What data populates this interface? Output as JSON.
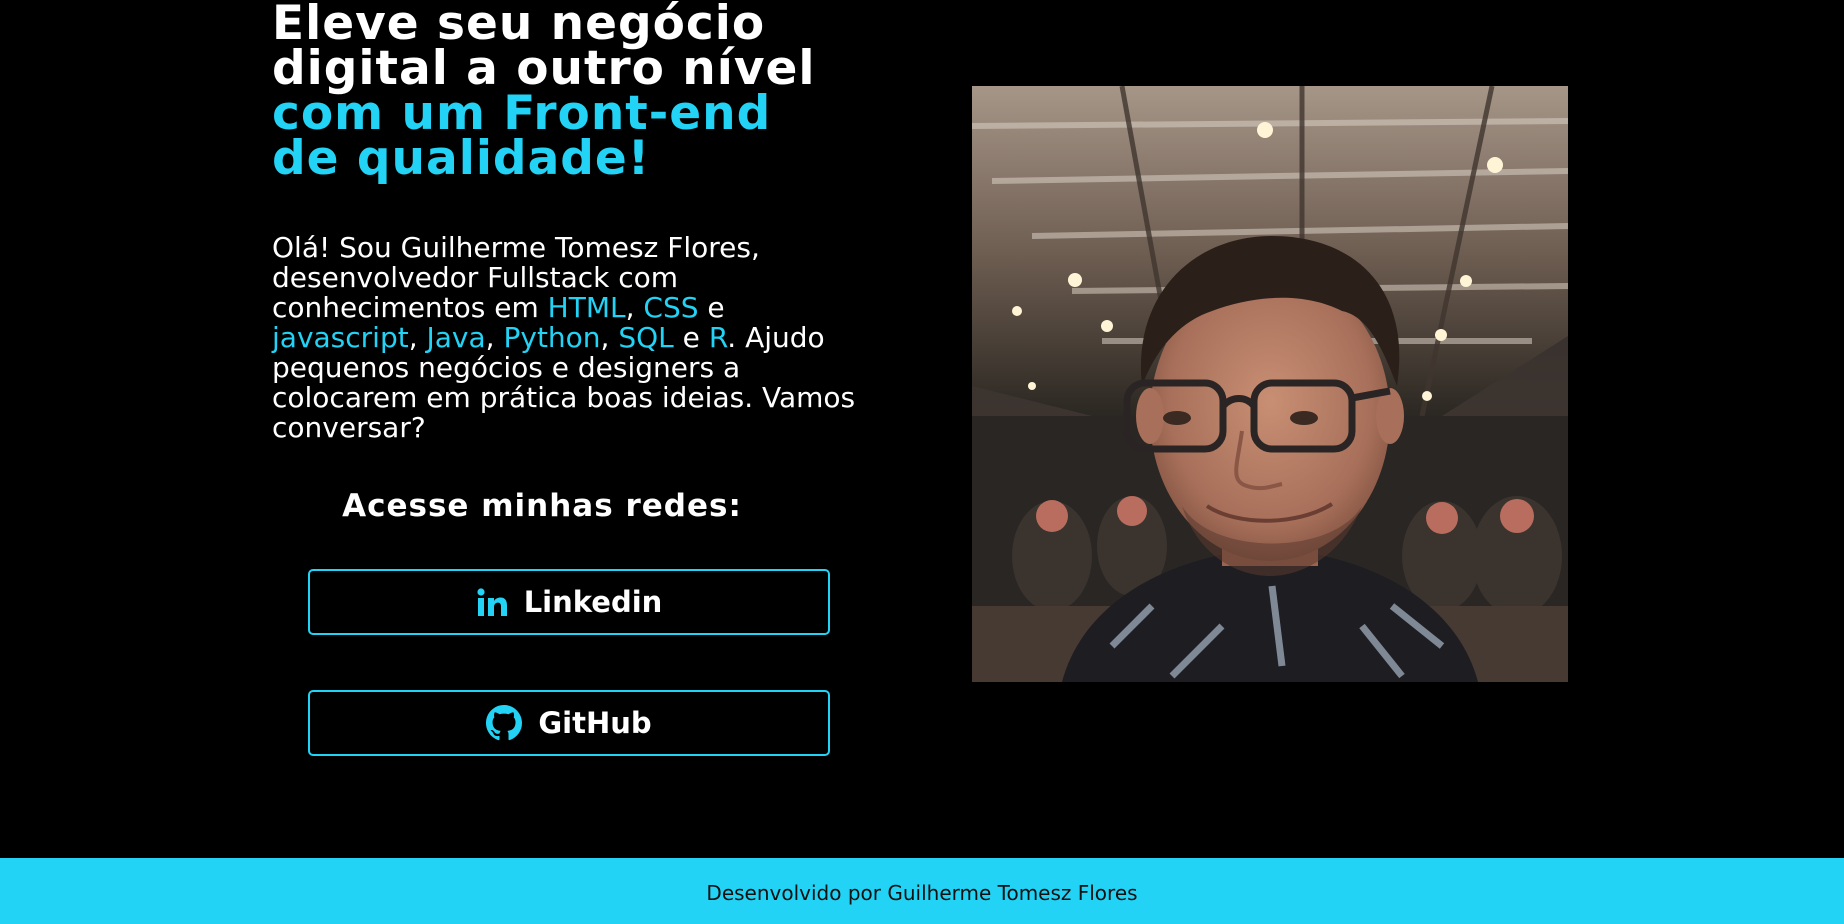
{
  "colors": {
    "background": "#000000",
    "accent": "#22d3f5",
    "text": "#ffffff",
    "footer_text": "#111111"
  },
  "hero": {
    "headline_lines": [
      "Eleve seu negócio",
      "digital a outro nível",
      "com um Front-end",
      "de qualidade!"
    ],
    "intro": {
      "part1": "Olá! Sou Guilherme Tomesz Flores, desenvolvedor Fullstack com conhecimentos em ",
      "sep_comma": ", ",
      "sep_and": " e ",
      "part_end": ". Ajudo pequenos negócios e designers a colocarem em prática boas ideias. Vamos conversar?",
      "technologies": [
        "HTML",
        "CSS",
        "javascript",
        "Java",
        "Python",
        "SQL",
        "R"
      ]
    }
  },
  "networks": {
    "title": "Acesse minhas redes:",
    "linkedin": {
      "label": "Linkedin",
      "icon": "linkedin-icon"
    },
    "github": {
      "label": "GitHub",
      "icon": "github-icon"
    }
  },
  "photo": {
    "alt": "profile-photo"
  },
  "footer": {
    "text": "Desenvolvido por Guilherme Tomesz Flores"
  }
}
